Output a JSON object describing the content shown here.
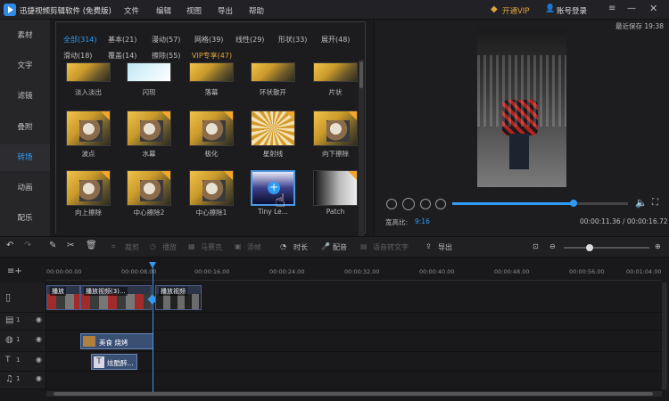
{
  "app": {
    "title": "迅捷视频剪辑软件 (免费版)",
    "vip": "开通VIP",
    "login": "账号登录",
    "save_status": "最近保存 19:38"
  },
  "menu": [
    "文件",
    "编辑",
    "视图",
    "导出",
    "帮助"
  ],
  "sidebar": [
    {
      "label": "素材"
    },
    {
      "label": "文字"
    },
    {
      "label": "滤镜"
    },
    {
      "label": "叠附"
    },
    {
      "label": "转场",
      "active": true
    },
    {
      "label": "动画"
    },
    {
      "label": "配乐"
    }
  ],
  "tabs_row1": [
    {
      "label": "全部(314)",
      "active": true
    },
    {
      "label": "基本(21)"
    },
    {
      "label": "漫动(57)"
    },
    {
      "label": "网格(39)"
    },
    {
      "label": "线性(29)"
    },
    {
      "label": "形状(33)"
    },
    {
      "label": "展开(48)"
    }
  ],
  "tabs_row2": [
    {
      "label": "滑动(18)"
    },
    {
      "label": "覆盖(14)"
    },
    {
      "label": "擦除(55)"
    },
    {
      "label": "VIP专享(47)",
      "vip": true
    }
  ],
  "transitions_row0": [
    "淡入淡出",
    "闪现",
    "落幕",
    "环状散开",
    "片状"
  ],
  "transitions_row1": [
    "波点",
    "水幕",
    "极化",
    "星射线",
    "向下擦除"
  ],
  "transitions_row2": [
    "向上擦除",
    "中心擦除2",
    "中心擦除1",
    "Tiny Le...",
    "Patch"
  ],
  "preview": {
    "aspect_label": "宽高比:",
    "aspect_value": "9:16",
    "time": "00:00:11.36 / 00:00:16.72",
    "progress": 0.69,
    "volume": 0.8
  },
  "toolbar": {
    "crop": "裁剪",
    "speed": "播放",
    "mosaic": "马赛克",
    "freeze": "添帧",
    "duration": "时长",
    "dub": "配音",
    "speech": "语音转文字",
    "export": "导出"
  },
  "ruler": [
    "00:00:00.00",
    "00:00:08.00",
    "00:00:16.00",
    "00:00:24.00",
    "00:00:32.00",
    "00:00:40.00",
    "00:00:48.00",
    "00:00:56.00",
    "00:01:04.00"
  ],
  "clips": {
    "video1": "播放",
    "video2": "播放视频(3)...",
    "video3": "播放视频",
    "caption": "美食 烧烤",
    "text": "炫酷醉..."
  },
  "track_labels": [
    "1",
    "1",
    "1",
    "1"
  ],
  "colors": {
    "accent": "#2f9bf5",
    "vip": "#e0a43b"
  }
}
